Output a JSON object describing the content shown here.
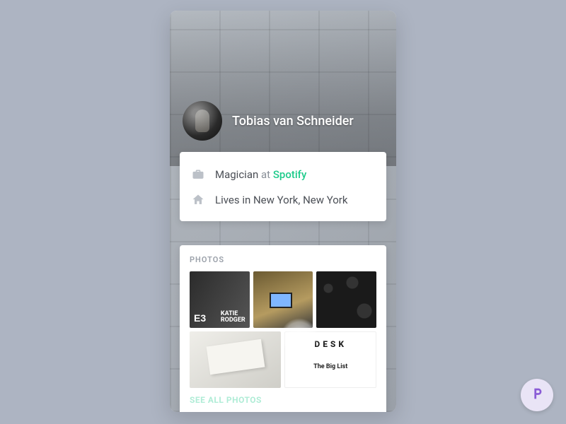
{
  "colors": {
    "accent": "#1ecb8b"
  },
  "profile": {
    "name": "Tobias van Schneider",
    "job_title": "Magician",
    "job_at_word": "at",
    "company": "Spotify",
    "lives_in_prefix": "Lives in",
    "location": "New York, New York"
  },
  "photos": {
    "section_label": "PHOTOS",
    "see_all_label": "SEE ALL PHOTOS",
    "items": [
      {
        "name": "photo-e3-katie-rodger"
      },
      {
        "name": "photo-desk-setup"
      },
      {
        "name": "photo-gear-flatlay"
      },
      {
        "name": "photo-paper-cutout"
      },
      {
        "name": "photo-desk-newsletter"
      }
    ]
  }
}
